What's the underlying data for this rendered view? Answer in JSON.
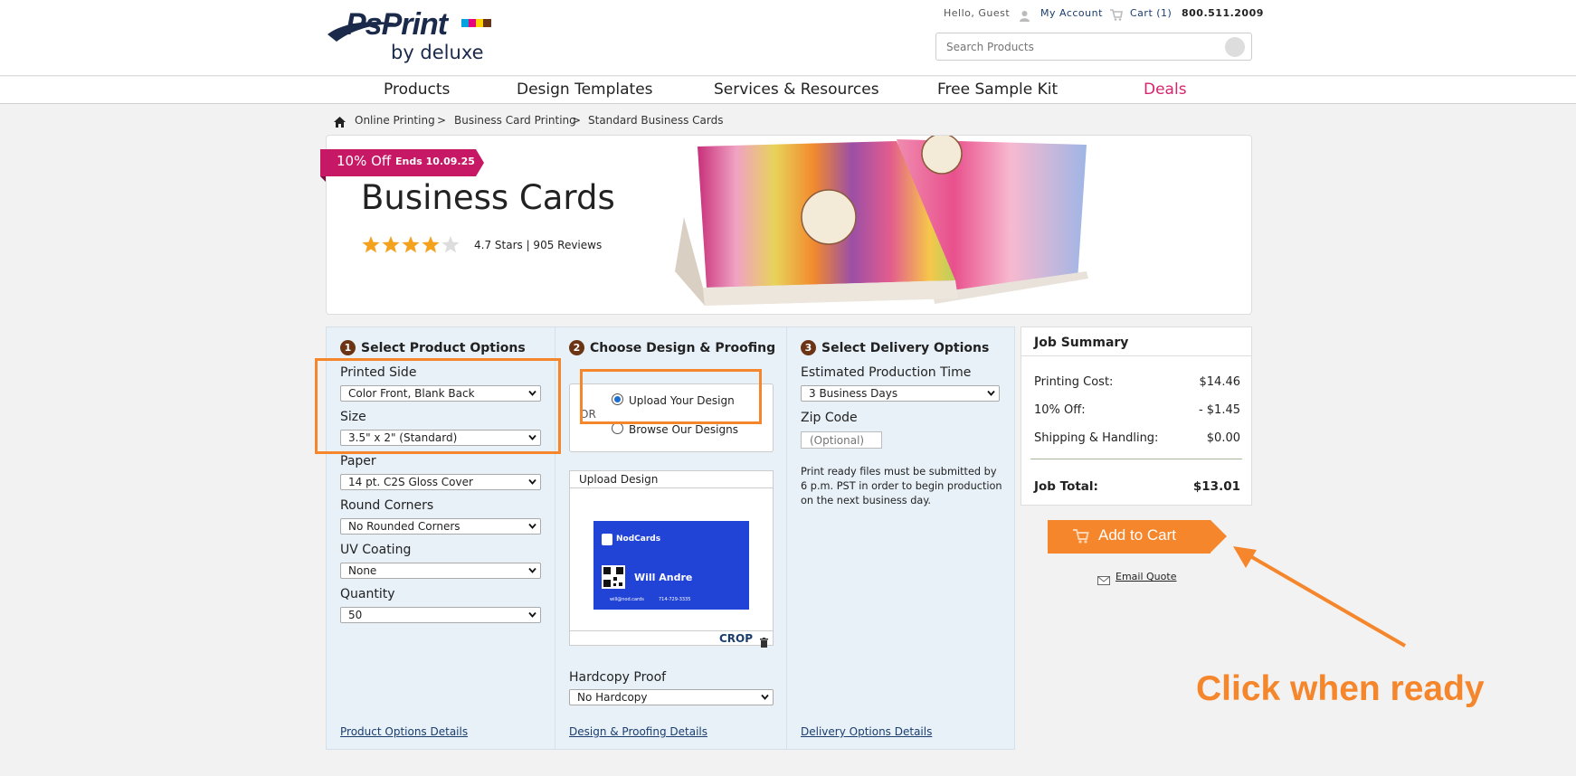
{
  "header": {
    "logo_text": "PsPrint",
    "logo_sub": "by deluxe",
    "greeting": "Hello, Guest",
    "my_account": "My Account",
    "cart": "Cart (1)",
    "phone": "800.511.2009",
    "search_placeholder": "Search Products"
  },
  "nav": {
    "items": [
      "Products",
      "Design Templates",
      "Services & Resources",
      "Free Sample Kit",
      "Deals"
    ]
  },
  "breadcrumb": [
    "Online Printing",
    ">",
    "Business Card Printing",
    ">",
    "Standard Business Cards"
  ],
  "hero": {
    "promo_discount": "10% Off",
    "promo_ends": "Ends 10.09.25",
    "title": "Business Cards",
    "rating_text": "4.7 Stars | 905 Reviews",
    "rating_stars": 4.7
  },
  "step1": {
    "number": "1",
    "title": "Select Product Options",
    "fields": [
      {
        "label": "Printed Side",
        "value": "Color Front, Blank Back"
      },
      {
        "label": "Size",
        "value": "3.5\" x 2\" (Standard)"
      },
      {
        "label": "Paper",
        "value": "14 pt. C2S Gloss Cover"
      },
      {
        "label": "Round Corners",
        "value": "No Rounded Corners"
      },
      {
        "label": "UV Coating",
        "value": "None"
      },
      {
        "label": "Quantity",
        "value": "50"
      }
    ],
    "details_link": "Product Options Details"
  },
  "step2": {
    "number": "2",
    "title": "Choose Design & Proofing",
    "option_upload": "Upload Your Design",
    "option_or": "OR",
    "option_browse": "Browse Our Designs",
    "upload_header": "Upload Design",
    "card_brand": "NodCards",
    "card_name": "Will Andre",
    "card_email": "will@nod.cards",
    "card_phone": "714-729-3335",
    "crop_label": "CROP",
    "hardcopy_label": "Hardcopy Proof",
    "hardcopy_value": "No Hardcopy",
    "details_link": "Design & Proofing Details"
  },
  "step3": {
    "number": "3",
    "title": "Select Delivery Options",
    "production_label": "Estimated Production Time",
    "production_value": "3 Business Days",
    "zip_label": "Zip Code",
    "zip_placeholder": "(Optional)",
    "note": "Print ready files must be submitted by 6 p.m. PST in order to begin production on the next business day.",
    "details_link": "Delivery Options Details"
  },
  "summary": {
    "title": "Job Summary",
    "rows": [
      {
        "label": "Printing Cost:",
        "value": "$14.46"
      },
      {
        "label": "10% Off:",
        "value": "- $1.45"
      },
      {
        "label": "Shipping & Handling:",
        "value": "$0.00"
      }
    ],
    "total_label": "Job Total:",
    "total_value": "$13.01",
    "add_to_cart": "Add to Cart",
    "email_quote": "Email Quote"
  },
  "annotation": {
    "callout": "Click when ready",
    "color": "#f5862b"
  },
  "colors": {
    "promo": "#c71865",
    "deals": "#d6246e",
    "cta": "#f5862b",
    "step_badge": "#6b3415",
    "panel_bg": "#e8f1f8"
  }
}
